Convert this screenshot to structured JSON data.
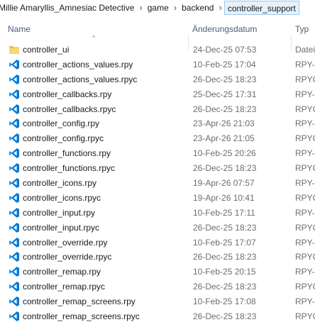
{
  "breadcrumb": {
    "items": [
      "Millie Amaryllis_Amnesiac Detective",
      "game",
      "backend",
      "controller_support"
    ],
    "separator": "›"
  },
  "header": {
    "name_label": "Name",
    "date_label": "Änderungsdatum",
    "type_label": "Typ",
    "sort_indicator": "^"
  },
  "colors": {
    "vscode_blue": "#0078d4",
    "folder_yellow": "#f8d775",
    "current_crumb_bg": "#e5f1fb"
  },
  "files": [
    {
      "name": "controller_ui",
      "date": "24-Dec-25 07:53",
      "type": "Datei",
      "icon": "folder-icon"
    },
    {
      "name": "controller_actions_values.rpy",
      "date": "10-Feb-25 17:04",
      "type": "RPY-I",
      "icon": "vscode-file-icon"
    },
    {
      "name": "controller_actions_values.rpyc",
      "date": "26-Dec-25 18:23",
      "type": "RPYC",
      "icon": "vscode-file-icon"
    },
    {
      "name": "controller_callbacks.rpy",
      "date": "25-Dec-25 17:31",
      "type": "RPY-I",
      "icon": "vscode-file-icon"
    },
    {
      "name": "controller_callbacks.rpyc",
      "date": "26-Dec-25 18:23",
      "type": "RPYC",
      "icon": "vscode-file-icon"
    },
    {
      "name": "controller_config.rpy",
      "date": "23-Apr-26 21:03",
      "type": "RPY-I",
      "icon": "vscode-file-icon"
    },
    {
      "name": "controller_config.rpyc",
      "date": "23-Apr-26 21:05",
      "type": "RPYC",
      "icon": "vscode-file-icon"
    },
    {
      "name": "controller_functions.rpy",
      "date": "10-Feb-25 20:26",
      "type": "RPY-I",
      "icon": "vscode-file-icon"
    },
    {
      "name": "controller_functions.rpyc",
      "date": "26-Dec-25 18:23",
      "type": "RPYC",
      "icon": "vscode-file-icon"
    },
    {
      "name": "controller_icons.rpy",
      "date": "19-Apr-26 07:57",
      "type": "RPY-I",
      "icon": "vscode-file-icon"
    },
    {
      "name": "controller_icons.rpyc",
      "date": "19-Apr-26 10:41",
      "type": "RPYC",
      "icon": "vscode-file-icon"
    },
    {
      "name": "controller_input.rpy",
      "date": "10-Feb-25 17:11",
      "type": "RPY-I",
      "icon": "vscode-file-icon"
    },
    {
      "name": "controller_input.rpyc",
      "date": "26-Dec-25 18:23",
      "type": "RPYC",
      "icon": "vscode-file-icon"
    },
    {
      "name": "controller_override.rpy",
      "date": "10-Feb-25 17:07",
      "type": "RPY-I",
      "icon": "vscode-file-icon"
    },
    {
      "name": "controller_override.rpyc",
      "date": "26-Dec-25 18:23",
      "type": "RPYC",
      "icon": "vscode-file-icon"
    },
    {
      "name": "controller_remap.rpy",
      "date": "10-Feb-25 20:15",
      "type": "RPY-I",
      "icon": "vscode-file-icon"
    },
    {
      "name": "controller_remap.rpyc",
      "date": "26-Dec-25 18:23",
      "type": "RPYC",
      "icon": "vscode-file-icon"
    },
    {
      "name": "controller_remap_screens.rpy",
      "date": "10-Feb-25 17:08",
      "type": "RPY-I",
      "icon": "vscode-file-icon"
    },
    {
      "name": "controller_remap_screens.rpyc",
      "date": "26-Dec-25 18:23",
      "type": "RPYC",
      "icon": "vscode-file-icon"
    }
  ]
}
